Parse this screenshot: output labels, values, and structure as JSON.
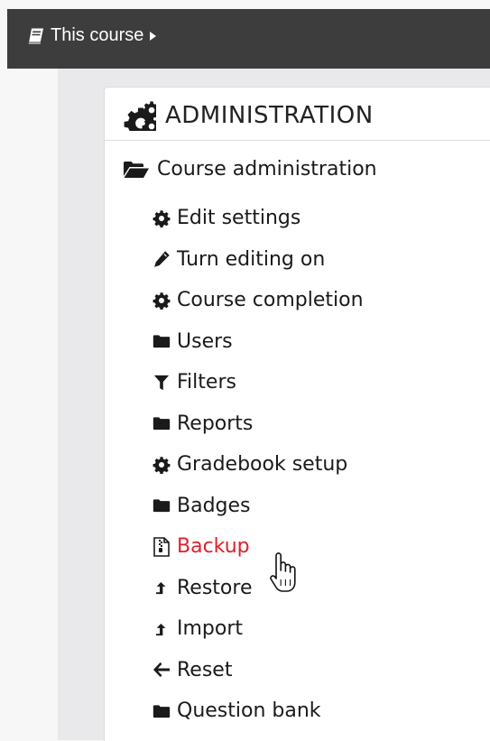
{
  "navbar": {
    "course_menu_label": "This course",
    "course_menu_icon": "book-icon",
    "caret_icon": "caret-right-icon"
  },
  "block": {
    "title": "ADMINISTRATION",
    "title_icon": "cogs-icon",
    "root_label": "Course administration",
    "root_icon": "folder-open-icon"
  },
  "admin_items": [
    {
      "label": "Edit settings",
      "icon": "gear-icon"
    },
    {
      "label": "Turn editing on",
      "icon": "pencil-icon"
    },
    {
      "label": "Course completion",
      "icon": "gear-icon"
    },
    {
      "label": "Users",
      "icon": "folder-icon"
    },
    {
      "label": "Filters",
      "icon": "filter-icon"
    },
    {
      "label": "Reports",
      "icon": "folder-icon"
    },
    {
      "label": "Gradebook setup",
      "icon": "gear-icon"
    },
    {
      "label": "Badges",
      "icon": "folder-icon"
    },
    {
      "label": "Backup",
      "icon": "file-archive-icon",
      "state": "hover"
    },
    {
      "label": "Restore",
      "icon": "upload-arrow-icon"
    },
    {
      "label": "Import",
      "icon": "upload-arrow-icon"
    },
    {
      "label": "Reset",
      "icon": "arrow-left-icon"
    },
    {
      "label": "Question bank",
      "icon": "folder-icon"
    }
  ],
  "colors": {
    "navbar_bg": "#3d3d3d",
    "hover_text": "#e0202d",
    "text": "#1a1a1a"
  },
  "cursor": "hand-pointer-icon"
}
